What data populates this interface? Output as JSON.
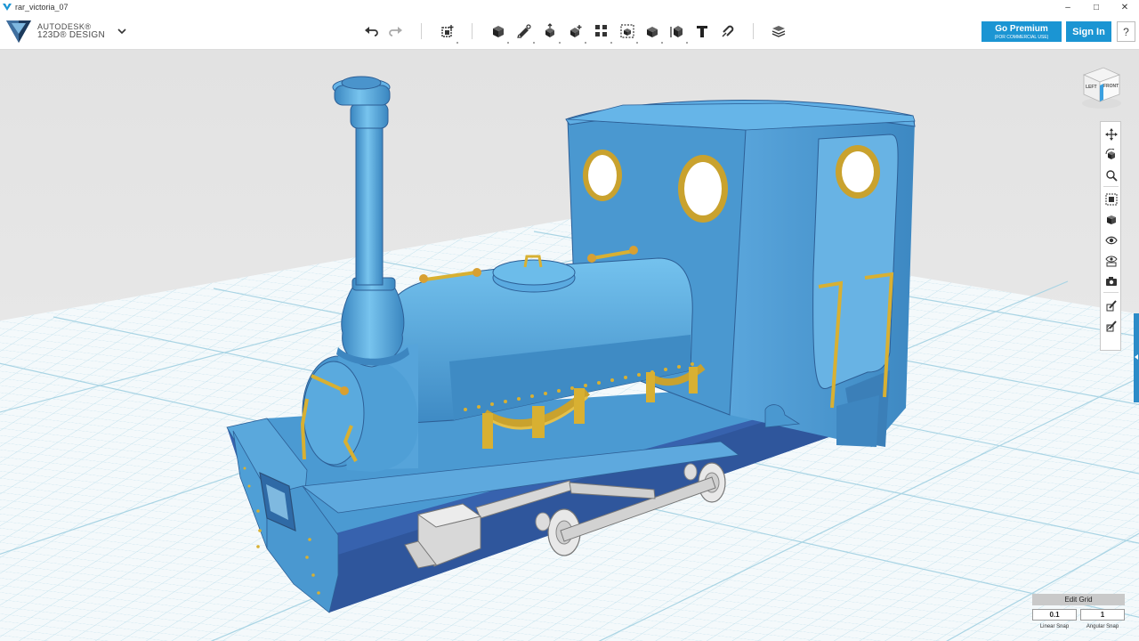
{
  "window": {
    "document_title": "rar_victoria_07",
    "controls": {
      "minimize": "–",
      "maximize": "□",
      "close": "✕"
    }
  },
  "brand": {
    "line1": "AUTODESK®",
    "line2": "123D® DESIGN",
    "menu_icon": "chevron-down-icon"
  },
  "toolbar": {
    "tools": [
      {
        "name": "undo",
        "icon": "undo-icon"
      },
      {
        "name": "redo",
        "icon": "redo-icon"
      },
      {
        "name": "transform",
        "icon": "transform-icon"
      },
      {
        "name": "primitives",
        "icon": "box-primitive-icon"
      },
      {
        "name": "sketch",
        "icon": "sketch-icon"
      },
      {
        "name": "construct",
        "icon": "construct-icon"
      },
      {
        "name": "modify",
        "icon": "modify-icon"
      },
      {
        "name": "pattern",
        "icon": "pattern-icon"
      },
      {
        "name": "grouping",
        "icon": "group-icon"
      },
      {
        "name": "combine",
        "icon": "combine-icon"
      },
      {
        "name": "measure",
        "icon": "measure-icon"
      },
      {
        "name": "text",
        "icon": "text-icon"
      },
      {
        "name": "snap",
        "icon": "snap-magnet-icon"
      },
      {
        "name": "material",
        "icon": "material-layers-icon"
      }
    ],
    "go_premium": {
      "label": "Go Premium",
      "sublabel": "(FOR COMMERCIAL USE)"
    },
    "sign_in": "Sign In",
    "help": "?"
  },
  "viewcube": {
    "left_face": "LEFT",
    "front_face": "FRONT"
  },
  "navbar": {
    "items": [
      "pan",
      "orbit",
      "zoom",
      "fit",
      "perspective",
      "visibility",
      "materials",
      "screenshot",
      "edit-1",
      "edit-2"
    ]
  },
  "grid_panel": {
    "edit_grid": "Edit Grid",
    "linear_snap_value": "0.1",
    "angular_snap_value": "1",
    "linear_snap_label": "Linear Snap",
    "angular_snap_label": "Angular Snap"
  },
  "colors": {
    "accent": "#1b95d3",
    "model_body": "#4a98d0",
    "model_frame": "#3868b0",
    "brass": "#d8b032",
    "grid_line": "#b8dce8"
  }
}
